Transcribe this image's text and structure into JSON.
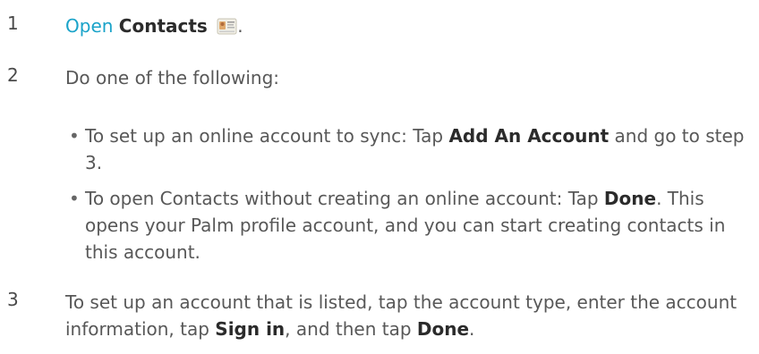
{
  "steps": [
    {
      "number": "1",
      "link_text": "Open",
      "bold_text": "Contacts",
      "icon": "contacts-app-icon",
      "suffix": "."
    },
    {
      "number": "2",
      "text": "Do one of the following:",
      "bullets": [
        {
          "pre": "To set up an online account to sync: Tap ",
          "bold": "Add An Account",
          "post": " and go to step 3."
        },
        {
          "pre": "To open Contacts without creating an online account: Tap ",
          "bold": "Done",
          "post": ". This opens your Palm profile account, and you can start creating contacts in this account."
        }
      ]
    },
    {
      "number": "3",
      "pre": "To set up an account that is listed, tap the account type, enter the account information, tap ",
      "bold1": "Sign in",
      "mid": ", and then tap ",
      "bold2": "Done",
      "post": "."
    }
  ],
  "colors": {
    "link": "#1aa3c9",
    "text": "#585858",
    "bold": "#2b2b2b"
  }
}
